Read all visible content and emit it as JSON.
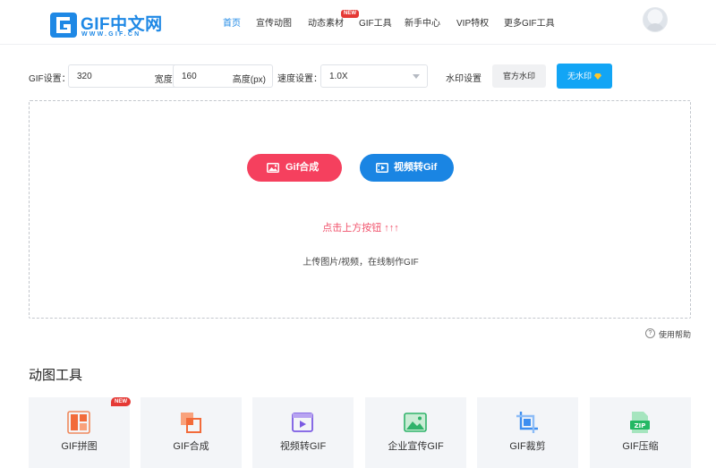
{
  "header": {
    "logo_text": "GIF中文网",
    "logo_sub": "WWW.GIF.CN",
    "nav": [
      {
        "label": "首页",
        "active": true
      },
      {
        "label": "宣传动图",
        "active": false
      },
      {
        "label": "动态素材",
        "active": false
      },
      {
        "label": "GIF工具",
        "active": false
      },
      {
        "label": "新手中心",
        "active": false
      },
      {
        "label": "VIP特权",
        "active": false
      },
      {
        "label": "更多GIF工具",
        "active": false
      }
    ],
    "nav_badge": "NEW"
  },
  "settings": {
    "gif_label": "GIF设置：",
    "width_value": "320",
    "width_unit": "宽度(px)",
    "height_value": "160",
    "height_unit": "高度(px)",
    "speed_label": "速度设置：",
    "speed_value": "1.0X",
    "watermark_label": "水印设置",
    "official_watermark": "官方水印",
    "no_watermark": "无水印"
  },
  "upload": {
    "gif_compose": "Gif合成",
    "video_to_gif": "视频转Gif",
    "hint_primary": "点击上方按钮 ↑↑↑",
    "hint_secondary": "上传图片/视频，在线制作GIF"
  },
  "help": {
    "icon": "?",
    "label": "使用帮助"
  },
  "tools_section": {
    "title": "动图工具",
    "badge": "NEW",
    "items": [
      {
        "label": "GIF拼图",
        "icon": "collage-icon"
      },
      {
        "label": "GIF合成",
        "icon": "compose-icon"
      },
      {
        "label": "视频转GIF",
        "icon": "video-icon"
      },
      {
        "label": "企业宣传GIF",
        "icon": "image-icon"
      },
      {
        "label": "GIF裁剪",
        "icon": "crop-icon"
      },
      {
        "label": "GIF压缩",
        "icon": "zip-icon"
      }
    ]
  },
  "colors": {
    "accent": "#1e88e5",
    "pink": "#f5405e",
    "blue_pill": "#1a85e3",
    "watermark_blue": "#12a5f5"
  }
}
